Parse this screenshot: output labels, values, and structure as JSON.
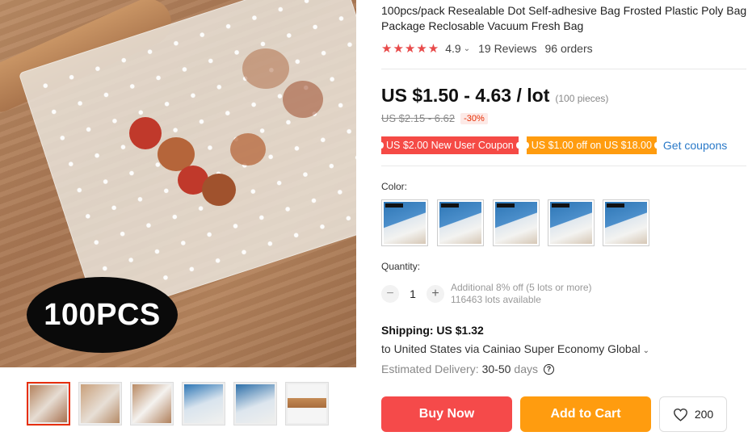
{
  "product": {
    "title": "100pcs/pack Resealable Dot Self-adhesive Bag Frosted Plastic Poly Bag Package Reclosable Vacuum Fresh Bag",
    "image_badge": "100PCS"
  },
  "rating": {
    "stars": "★★★★★",
    "score": "4.9",
    "reviews": "19 Reviews",
    "orders": "96 orders"
  },
  "price": {
    "range": "US $1.50 - 4.63 / lot",
    "unit_note": "(100 pieces)",
    "original": "US $2.15 - 6.62",
    "discount": "-30%"
  },
  "coupons": {
    "new_user": "US $2.00 New User Coupon",
    "store": "US $1.00 off on US $18.00",
    "get_link": "Get coupons"
  },
  "color": {
    "label": "Color:",
    "options": [
      "option-1",
      "option-2",
      "option-3",
      "option-4",
      "option-5"
    ]
  },
  "quantity": {
    "label": "Quantity:",
    "value": "1",
    "minus": "−",
    "plus": "+",
    "offer": "Additional 8% off (5 lots or more)",
    "available": "116463 lots available"
  },
  "shipping": {
    "cost": "Shipping: US $1.32",
    "destination": "to United States via Cainiao Super Economy Global",
    "eta_label": "Estimated Delivery:",
    "eta_days": "30-50",
    "eta_unit": "days",
    "help": "?"
  },
  "actions": {
    "buy_now": "Buy Now",
    "add_to_cart": "Add to Cart",
    "wishlist_count": "200"
  },
  "colors": {
    "buy_now": "#f54a4a",
    "add_to_cart": "#ff9c0f",
    "stars": "#e84a4a",
    "link": "#2979c8",
    "active_thumb_border": "#e62e04"
  },
  "icons": {
    "rating": "star-icon",
    "wishlist": "heart-icon",
    "help": "question-circle-icon",
    "dropdown": "chevron-down-icon"
  }
}
